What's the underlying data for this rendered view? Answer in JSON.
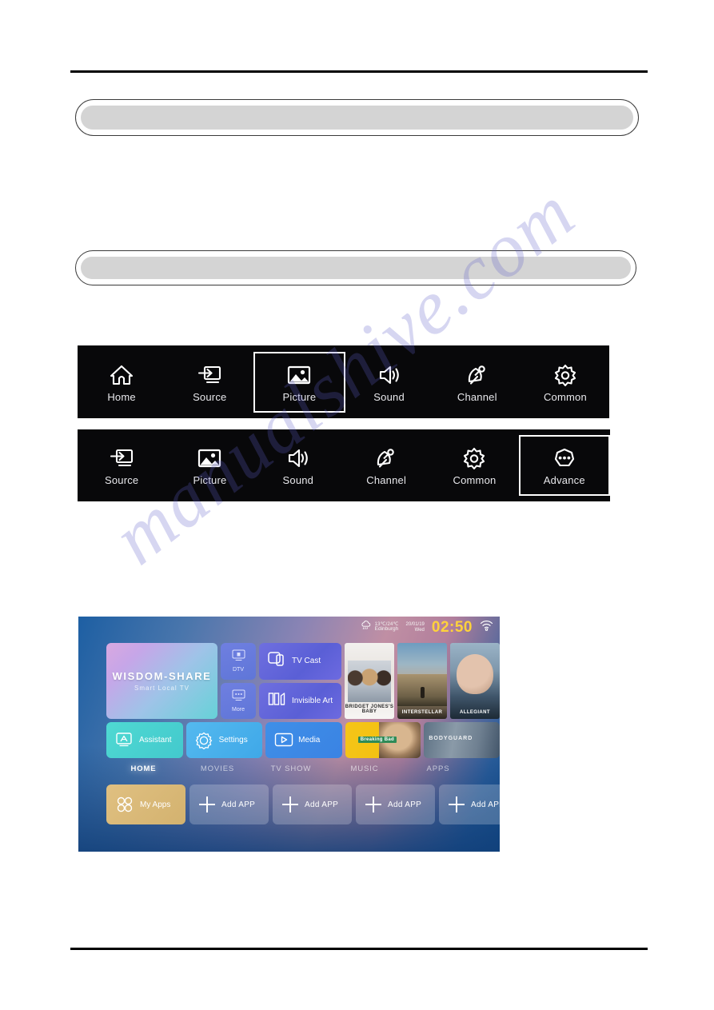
{
  "page": {
    "redacted_bars": [
      {
        "name": "heading-bar-1"
      },
      {
        "name": "heading-bar-2"
      }
    ]
  },
  "osd_menu_row_1": {
    "name": "tv-osd-menu-primary",
    "items": [
      {
        "label": "Home",
        "icon": "home-icon",
        "selected": false
      },
      {
        "label": "Source",
        "icon": "source-icon",
        "selected": false
      },
      {
        "label": "Picture",
        "icon": "picture-icon",
        "selected": true
      },
      {
        "label": "Sound",
        "icon": "speaker-icon",
        "selected": false
      },
      {
        "label": "Channel",
        "icon": "satellite-icon",
        "selected": false
      },
      {
        "label": "Common",
        "icon": "gear-icon",
        "selected": false
      }
    ]
  },
  "osd_menu_row_2": {
    "name": "tv-osd-menu-secondary",
    "items": [
      {
        "label": "Source",
        "icon": "source-icon",
        "selected": false
      },
      {
        "label": "Picture",
        "icon": "picture-icon",
        "selected": false
      },
      {
        "label": "Sound",
        "icon": "speaker-icon",
        "selected": false
      },
      {
        "label": "Channel",
        "icon": "satellite-icon",
        "selected": false
      },
      {
        "label": "Common",
        "icon": "gear-icon",
        "selected": false
      },
      {
        "label": "Advance",
        "icon": "ellipsis-hexagon-icon",
        "selected": true
      }
    ]
  },
  "tv_home": {
    "status_bar": {
      "weather_icon": "rain-cloud-icon",
      "temperature": "13℃/24℃",
      "city": "Edinburgh",
      "date": "20/01/19",
      "weekday": "Wed",
      "time": "02:50",
      "wifi_icon": "wifi-icon"
    },
    "hero_tile": {
      "title": "WISDOM-SHARE",
      "subtitle": "Smart Local TV"
    },
    "narrow_tiles": [
      {
        "label": "DTV",
        "icon": "tv-dtv-icon"
      },
      {
        "label": "More",
        "icon": "tv-more-icon"
      }
    ],
    "mid_tiles": [
      {
        "label": "TV Cast",
        "icon": "cast-icon"
      },
      {
        "label": "Invisible Art",
        "icon": "art-gallery-icon"
      }
    ],
    "posters": [
      {
        "title": "BRIDGET JONES'S BABY"
      },
      {
        "title": "INTERSTELLAR"
      },
      {
        "title": "ALLEGIANT"
      }
    ],
    "app_tiles": [
      {
        "label": "Assistant",
        "icon": "assistant-icon"
      },
      {
        "label": "Settings",
        "icon": "gear-icon"
      },
      {
        "label": "Media",
        "icon": "play-icon"
      }
    ],
    "show_cards": [
      {
        "title": "Breaking Bad"
      },
      {
        "title": "BODYGUARD"
      }
    ],
    "nav_tabs": [
      {
        "label": "HOME",
        "active": true
      },
      {
        "label": "MOVIES",
        "active": false
      },
      {
        "label": "TV SHOW",
        "active": false
      },
      {
        "label": "MUSIC",
        "active": false
      },
      {
        "label": "APPS",
        "active": false
      }
    ],
    "app_row": [
      {
        "label": "My Apps",
        "icon": "grid-apps-icon",
        "type": "myapps"
      },
      {
        "label": "Add APP",
        "icon": "plus-icon",
        "type": "add"
      },
      {
        "label": "Add APP",
        "icon": "plus-icon",
        "type": "add"
      },
      {
        "label": "Add APP",
        "icon": "plus-icon",
        "type": "add"
      },
      {
        "label": "Add APP",
        "icon": "plus-icon",
        "type": "add"
      }
    ]
  },
  "watermark": {
    "text": "manualshive.com"
  },
  "colors": {
    "osd_background": "#08080a",
    "osd_text": "#e8e8ec",
    "clock_yellow": "#ffd23b",
    "redacted_fill": "#d4d4d4",
    "rule": "#000000",
    "watermark": "#6060c8"
  }
}
